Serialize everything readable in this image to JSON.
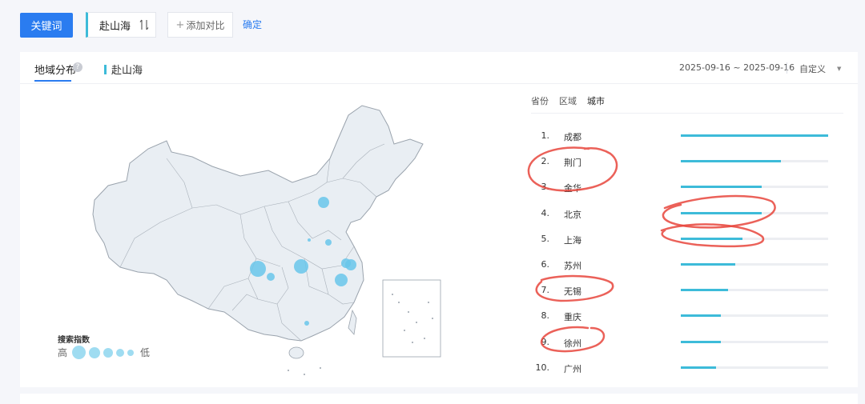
{
  "toolbar": {
    "keyword_button": "关键词",
    "keyword": "赴山海",
    "add_compare": "添加对比",
    "confirm": "确定"
  },
  "card": {
    "tab_label": "地域分布",
    "help_icon": "?",
    "legend_keyword": "赴山海",
    "date_range": "2025-09-16 ~ 2025-09-16",
    "custom_select": "自定义"
  },
  "map": {
    "legend_title": "搜索指数",
    "legend_high": "高",
    "legend_low": "低",
    "accent_color": "#9fdcf1"
  },
  "ranking": {
    "tabs": [
      "省份",
      "区域",
      "城市"
    ],
    "active_tab": "城市",
    "items": [
      {
        "rank": "1.",
        "name": "成都",
        "share": 1.0
      },
      {
        "rank": "2.",
        "name": "荆门",
        "share": 0.68
      },
      {
        "rank": "3.",
        "name": "金华",
        "share": 0.55
      },
      {
        "rank": "4.",
        "name": "北京",
        "share": 0.55
      },
      {
        "rank": "5.",
        "name": "上海",
        "share": 0.42
      },
      {
        "rank": "6.",
        "name": "苏州",
        "share": 0.37
      },
      {
        "rank": "7.",
        "name": "无锡",
        "share": 0.32
      },
      {
        "rank": "8.",
        "name": "重庆",
        "share": 0.27
      },
      {
        "rank": "9.",
        "name": "徐州",
        "share": 0.27
      },
      {
        "rank": "10.",
        "name": "广州",
        "share": 0.24
      }
    ],
    "bar_color": "#3dbbd9"
  }
}
